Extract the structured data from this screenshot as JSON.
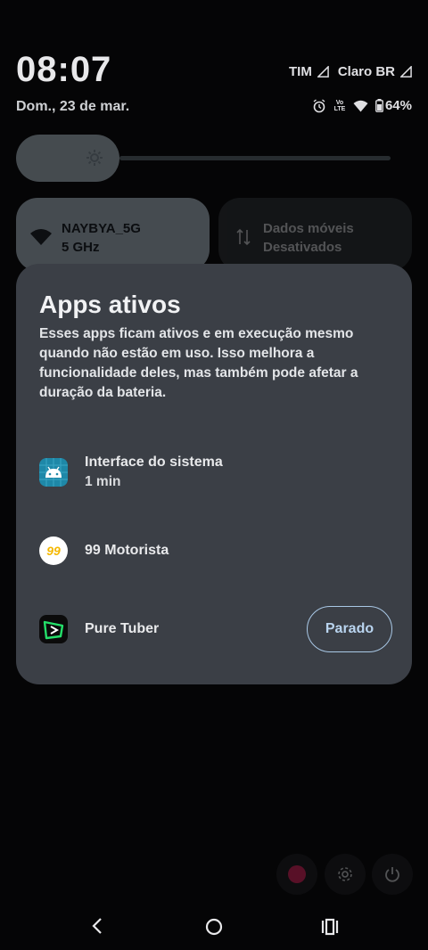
{
  "status": {
    "time": "08:07",
    "date": "Dom., 23 de mar.",
    "carrier1": "TIM",
    "carrier2": "Claro BR",
    "volte": "VoLTE",
    "battery": "64%"
  },
  "brightness": {
    "level": 0.25
  },
  "tiles": {
    "wifi": {
      "ssid": "NAYBYA_5G",
      "band": "5 GHz"
    },
    "mobile": {
      "label": "Dados móveis",
      "state": "Desativados"
    }
  },
  "dialog": {
    "title": "Apps ativos",
    "description": "Esses apps ficam ativos e em execução mesmo quando não estão em uso. Isso melhora a funcionalidade deles, mas também pode afetar a duração da bateria.",
    "apps": [
      {
        "name": "Interface do sistema",
        "detail": "1 min",
        "icon": "android-icon"
      },
      {
        "name": "99 Motorista",
        "detail": "",
        "icon": "99-logo-icon",
        "icon_text": "99"
      },
      {
        "name": "Pure Tuber",
        "detail": "",
        "icon": "pure-tuber-icon",
        "button": "Parado"
      }
    ]
  },
  "colors": {
    "accent": "#a9c8e6",
    "panel": "#3b3f46",
    "tile_active": "#aebcc8"
  }
}
